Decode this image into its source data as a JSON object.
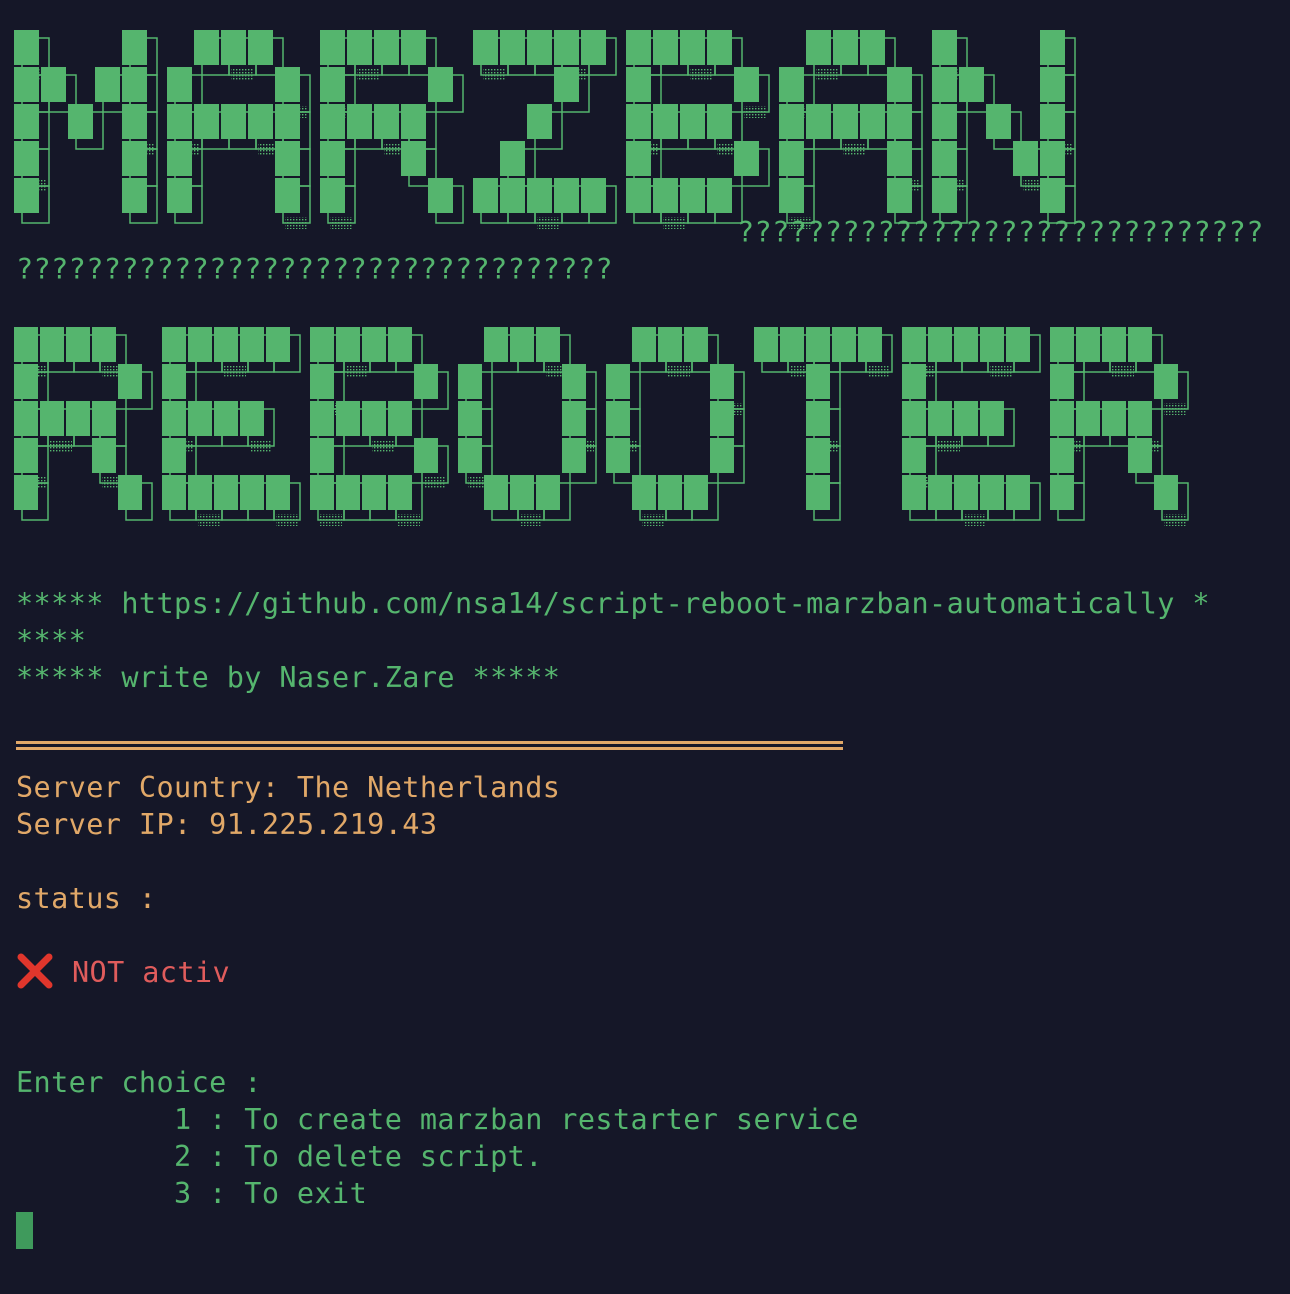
{
  "banner": {
    "line1": "MARZBAN",
    "line2": "REBOOTER",
    "overflow_1": "??????????????????????????????",
    "overflow_2": "??????????????????????????????????"
  },
  "header": {
    "repo_line_1": "***** https://github.com/nsa14/script-reboot-marzban-automatically *",
    "repo_line_2": "****",
    "author_line": "***** write by Naser.Zare *****"
  },
  "server": {
    "country_line": "Server Country: The Netherlands",
    "ip_line": "Server IP: 91.225.219.43"
  },
  "status": {
    "label": "status :",
    "icon": "cross-mark-icon",
    "value": "NOT activ"
  },
  "menu": {
    "prompt": "Enter choice :",
    "options": [
      "         1 : To create marzban restarter service",
      "         2 : To delete script.",
      "         3 : To exit"
    ]
  },
  "colors": {
    "background": "#151728",
    "green": "#55b56e",
    "orange": "#e1a868",
    "red": "#e05c5c",
    "cross": "#e0362c",
    "cursor": "#3f9a5c"
  }
}
